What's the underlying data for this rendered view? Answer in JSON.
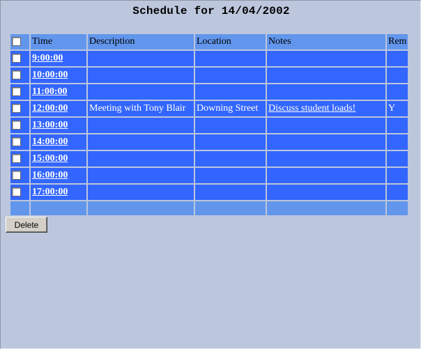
{
  "title": "Schedule for 14/04/2002",
  "columns": {
    "time": "Time",
    "description": "Description",
    "location": "Location",
    "notes": "Notes",
    "reminder": "Rem"
  },
  "rows": [
    {
      "time": "9:00:00",
      "description": "",
      "location": "",
      "notes": "",
      "reminder": ""
    },
    {
      "time": "10:00:00",
      "description": "",
      "location": "",
      "notes": "",
      "reminder": ""
    },
    {
      "time": "11:00:00",
      "description": "",
      "location": "",
      "notes": "",
      "reminder": ""
    },
    {
      "time": "12:00:00",
      "description": "Meeting with Tony Blair",
      "location": "Downing Street",
      "notes": "Discuss student loads! ",
      "reminder": "Y"
    },
    {
      "time": "13:00:00",
      "description": "",
      "location": "",
      "notes": "",
      "reminder": ""
    },
    {
      "time": "14:00:00",
      "description": "",
      "location": "",
      "notes": "",
      "reminder": ""
    },
    {
      "time": "15:00:00",
      "description": "",
      "location": "",
      "notes": "",
      "reminder": ""
    },
    {
      "time": "16:00:00",
      "description": "",
      "location": "",
      "notes": "",
      "reminder": ""
    },
    {
      "time": "17:00:00",
      "description": "",
      "location": "",
      "notes": "",
      "reminder": ""
    }
  ],
  "delete_label": "Delete",
  "colors": {
    "background": "#bcc6dc",
    "header": "#6296ec",
    "row": "#3366ff",
    "row_text": "#ffffff"
  }
}
